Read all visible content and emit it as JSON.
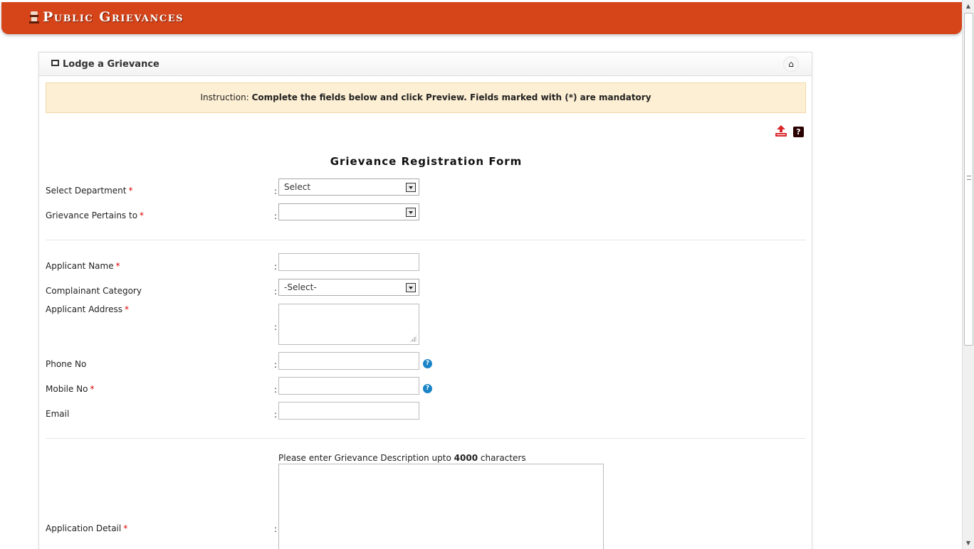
{
  "header": {
    "title": "Public Grievances",
    "emblem_icon": "state-emblem-icon",
    "color": "#d6451a"
  },
  "panel": {
    "title": "Lodge a Grievance",
    "title_icon": "picture-icon",
    "home_icon": "home-icon",
    "instruction_prefix": "Instruction:",
    "instruction_text": "Complete the fields below and click Preview. Fields marked with (*) are mandatory",
    "form_title": "Grievance Registration Form"
  },
  "fields": {
    "department": {
      "label": "Select Department",
      "required": "*",
      "value": "Select"
    },
    "pertains": {
      "label": "Grievance Pertains to",
      "required": "*",
      "value": ""
    },
    "applicant_name": {
      "label": "Applicant Name",
      "required": "*"
    },
    "category": {
      "label": "Complainant Category",
      "value": "-Select-"
    },
    "address": {
      "label": "Applicant Address",
      "required": "*"
    },
    "phone": {
      "label": "Phone No"
    },
    "mobile": {
      "label": "Mobile No",
      "required": "*"
    },
    "email": {
      "label": "Email"
    },
    "detail": {
      "label": "Application Detail",
      "required": "*",
      "hint_prefix": "Please enter Grievance Description upto",
      "hint_limit": "4000",
      "hint_suffix": "characters"
    }
  },
  "colon": ":",
  "help_glyph": "?",
  "home_glyph": "⌂"
}
